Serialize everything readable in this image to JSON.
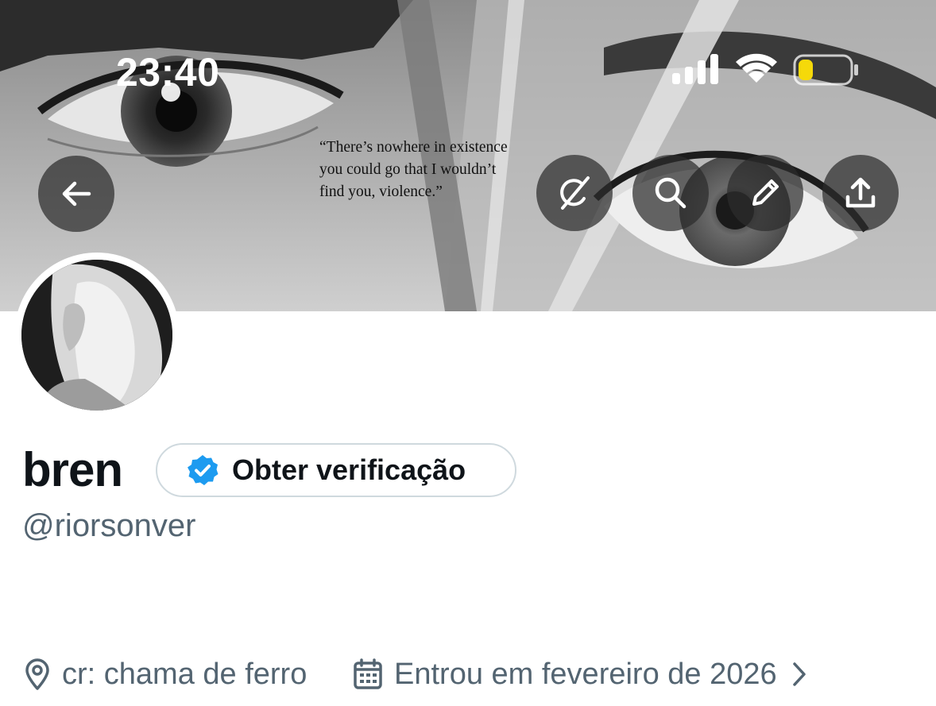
{
  "status_bar": {
    "time": "23:40",
    "icons": [
      "cellular-signal-icon",
      "wifi-icon",
      "battery-low-icon"
    ],
    "battery_color": "#f5d90a"
  },
  "banner": {
    "quote": "“There’s nowhere in existence\nyou could go that I wouldn’t\nfind you, violence.”"
  },
  "header_buttons": {
    "back": "back-arrow-icon",
    "actions": [
      "grok-icon",
      "search-icon",
      "pencil-icon",
      "share-icon"
    ]
  },
  "profile": {
    "display_name": "bren",
    "verify_label": "Obter verificação",
    "handle": "@riorsonver",
    "location": "cr: chama de ferro",
    "joined": "Entrou em fevereiro de 2026"
  },
  "colors": {
    "verified_blue": "#1d9bf0",
    "secondary_text": "#536471",
    "border": "#cfd9de"
  }
}
